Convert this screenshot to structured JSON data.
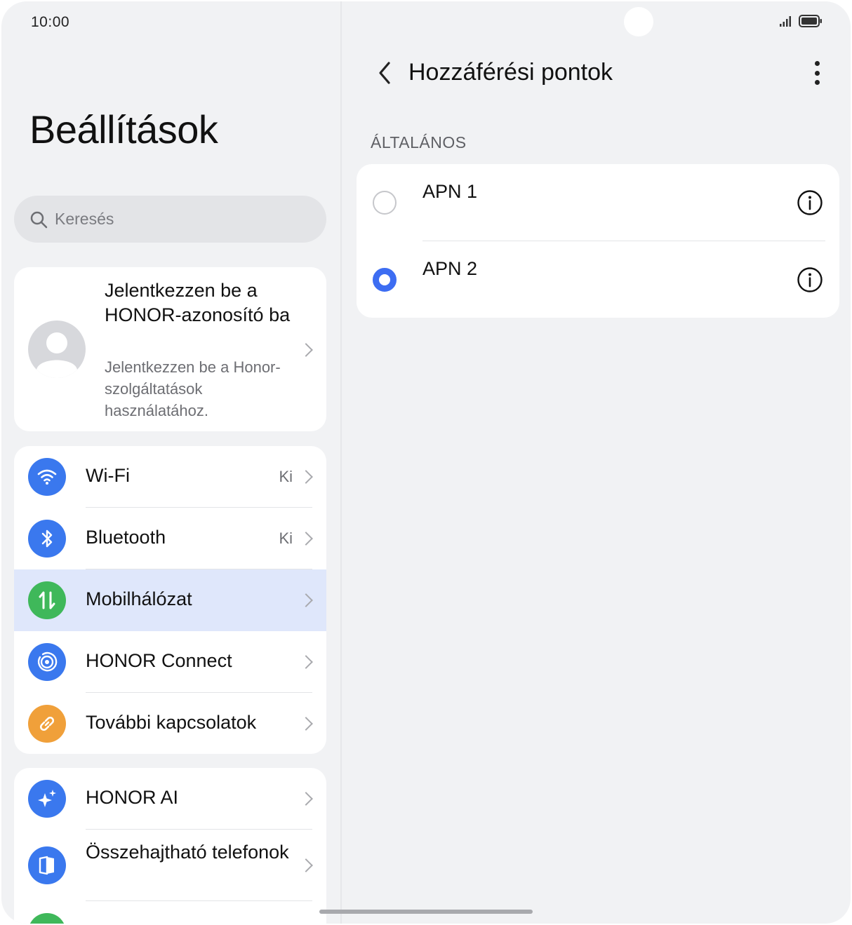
{
  "status_bar": {
    "time": "10:00"
  },
  "left_panel": {
    "title": "Beállítások",
    "search": {
      "placeholder": "Keresés"
    },
    "account": {
      "title": "Jelentkezzen be a HONOR-azonosító ba",
      "subtitle": "Jelentkezzen be a Honor-szolgáltatások használatához."
    },
    "group1": [
      {
        "label": "Wi-Fi",
        "value": "Ki",
        "icon": "wifi-icon",
        "color": "#3a78ee"
      },
      {
        "label": "Bluetooth",
        "value": "Ki",
        "icon": "bluetooth-icon",
        "color": "#3a78ee"
      },
      {
        "label": "Mobilhálózat",
        "value": "",
        "icon": "mobile-data-icon",
        "color": "#3fb85a",
        "selected": true
      },
      {
        "label": "HONOR Connect",
        "value": "",
        "icon": "honor-connect-icon",
        "color": "#3a78ee"
      },
      {
        "label": "További kapcsolatok",
        "value": "",
        "icon": "link-icon",
        "color": "#f0a03a"
      }
    ],
    "group2": [
      {
        "label": "HONOR AI",
        "icon": "sparkle-icon",
        "color": "#3a78ee"
      },
      {
        "label": "Összehajtható telefonok",
        "icon": "foldable-phone-icon",
        "color": "#3a78ee"
      }
    ]
  },
  "right_panel": {
    "title": "Hozzáférési pontok",
    "section_label": "ÁLTALÁNOS",
    "apns": [
      {
        "name": "APN 1",
        "selected": false
      },
      {
        "name": "APN 2",
        "selected": true
      }
    ],
    "accent_color": "#3d6df2"
  }
}
